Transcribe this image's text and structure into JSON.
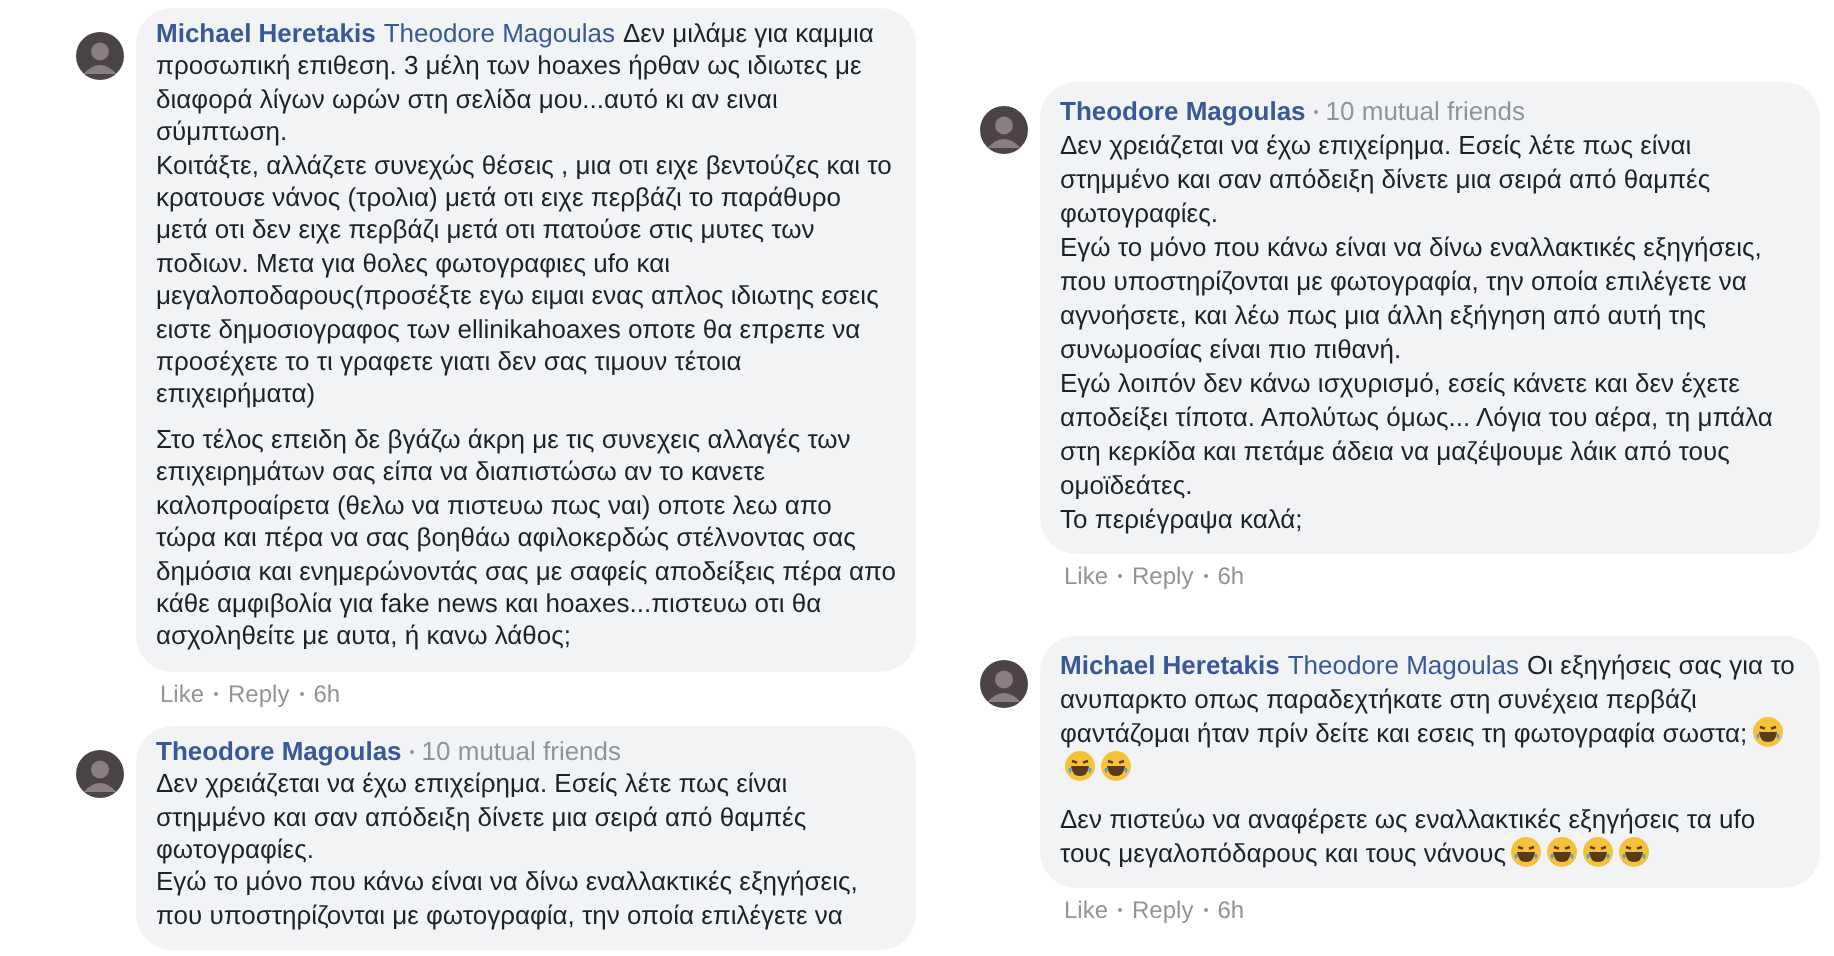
{
  "columns": [
    {
      "comments": [
        {
          "author": "Michael Heretakis",
          "mention": "Theodore Magoulas",
          "paragraphs": [
            {
              "text": "Δεν μιλάμε για καμμια προσωπική επιθεση. 3 μέλη των hoaxes ήρθαν ως ιδιωτες με διαφορά λίγων ωρών στη σελίδα μου...αυτό κι αν ειναι σύμπτωση.\nΚοιτάξτε, αλλάζετε συνεχώς θέσεις , μια οτι ειχε βεντούζες και το κρατουσε νάνος (τρολια) μετά οτι ειχε περβάζι το παράθυρο μετά οτι δεν ειχε περβάζι μετά οτι πατούσε στις μυτες των ποδιων. Μετα για θολες φωτογραφιες ufo και μεγαλοποδαρους(προσέξτε εγω ειμαι ενας απλος ιδιωτης εσεις ειστε δημοσιογραφος των ellinikahoaxes οποτε θα επρεπε να προσέχετε το τι γραφετε γιατι δεν σας τιμουν τέτοια επιχειρήματα)"
            },
            {
              "text": "Στο τέλος επειδη δε βγάζω άκρη με τις συνεχεις αλλαγές των επιχειρημάτων σας είπα να διαπιστώσω αν το κανετε καλοπροαίρετα (θελω να πιστευω πως ναι) οποτε λεω απο τώρα και πέρα να σας βοηθάω αφιλοκερδώς στέλνοντας σας δημόσια και ενημερώνοντάς σας με σαφείς αποδείξεις πέρα απο κάθε αμφιβολία για fake news και hoaxes...πιστευω οτι θα ασχοληθείτε με αυτα, ή κανω λάθος;"
            }
          ],
          "actions": [
            "Like",
            "Reply"
          ],
          "time": "6h"
        },
        {
          "author": "Theodore Magoulas",
          "mutual": "10 mutual friends",
          "paragraphs": [
            {
              "text": "Δεν χρειάζεται να έχω επιχείρημα. Εσείς λέτε πως είναι στημμένο και σαν απόδειξη δίνετε μια σειρά από θαμπές φωτογραφίες.\nΕγώ το μόνο που κάνω είναι να δίνω εναλλακτικές εξηγήσεις, που υποστηρίζονται με φωτογραφία, την οποία επιλέγετε να"
            }
          ]
        }
      ]
    },
    {
      "comments": [
        {
          "author": "Theodore Magoulas",
          "mutual": "10 mutual friends",
          "paragraphs": [
            {
              "text": "Δεν χρειάζεται να έχω επιχείρημα. Εσείς λέτε πως είναι στημμένο και σαν απόδειξη δίνετε μια σειρά από θαμπές φωτογραφίες.\nΕγώ το μόνο που κάνω είναι να δίνω εναλλακτικές εξηγήσεις, που υποστηρίζονται με φωτογραφία, την οποία επιλέγετε να αγνοήσετε, και λέω πως μια άλλη εξήγηση από αυτή της συνωμοσίας είναι πιο πιθανή.\nΕγώ λοιπόν δεν κάνω ισχυρισμό, εσείς κάνετε και δεν έχετε αποδείξει τίποτα. Απολύτως όμως... Λόγια του αέρα, τη μπάλα στη κερκίδα και πετάμε άδεια να μαζέψουμε λάικ από τους ομοϊδεάτες.\nΤο περιέγραψα καλά;"
            }
          ],
          "actions": [
            "Like",
            "Reply"
          ],
          "time": "6h"
        },
        {
          "author": "Michael Heretakis",
          "mention": "Theodore Magoulas",
          "paragraphs": [
            {
              "text": "Οι εξηγήσεις σας για το ανυπαρκτο οπως παραδεχτήκατε στη συνέχεια περβάζι φαντάζομαι ήταν πρίν δείτε και εσεις τη φωτογραφία σωστα;",
              "emojis": [
                {
                  "kind": "laugh"
                },
                {
                  "kind": "laugh"
                },
                {
                  "kind": "laugh"
                }
              ]
            },
            {
              "text": "Δεν πιστεύω να αναφέρετε ως εναλλακτικές εξηγήσεις τα ufo τους μεγαλοπόδαρους και τους νάνους",
              "emojis": [
                {
                  "kind": "laugh"
                },
                {
                  "kind": "laugh"
                },
                {
                  "kind": "laugh"
                },
                {
                  "kind": "laugh"
                }
              ]
            }
          ],
          "actions": [
            "Like",
            "Reply"
          ],
          "time": "6h"
        }
      ]
    }
  ]
}
